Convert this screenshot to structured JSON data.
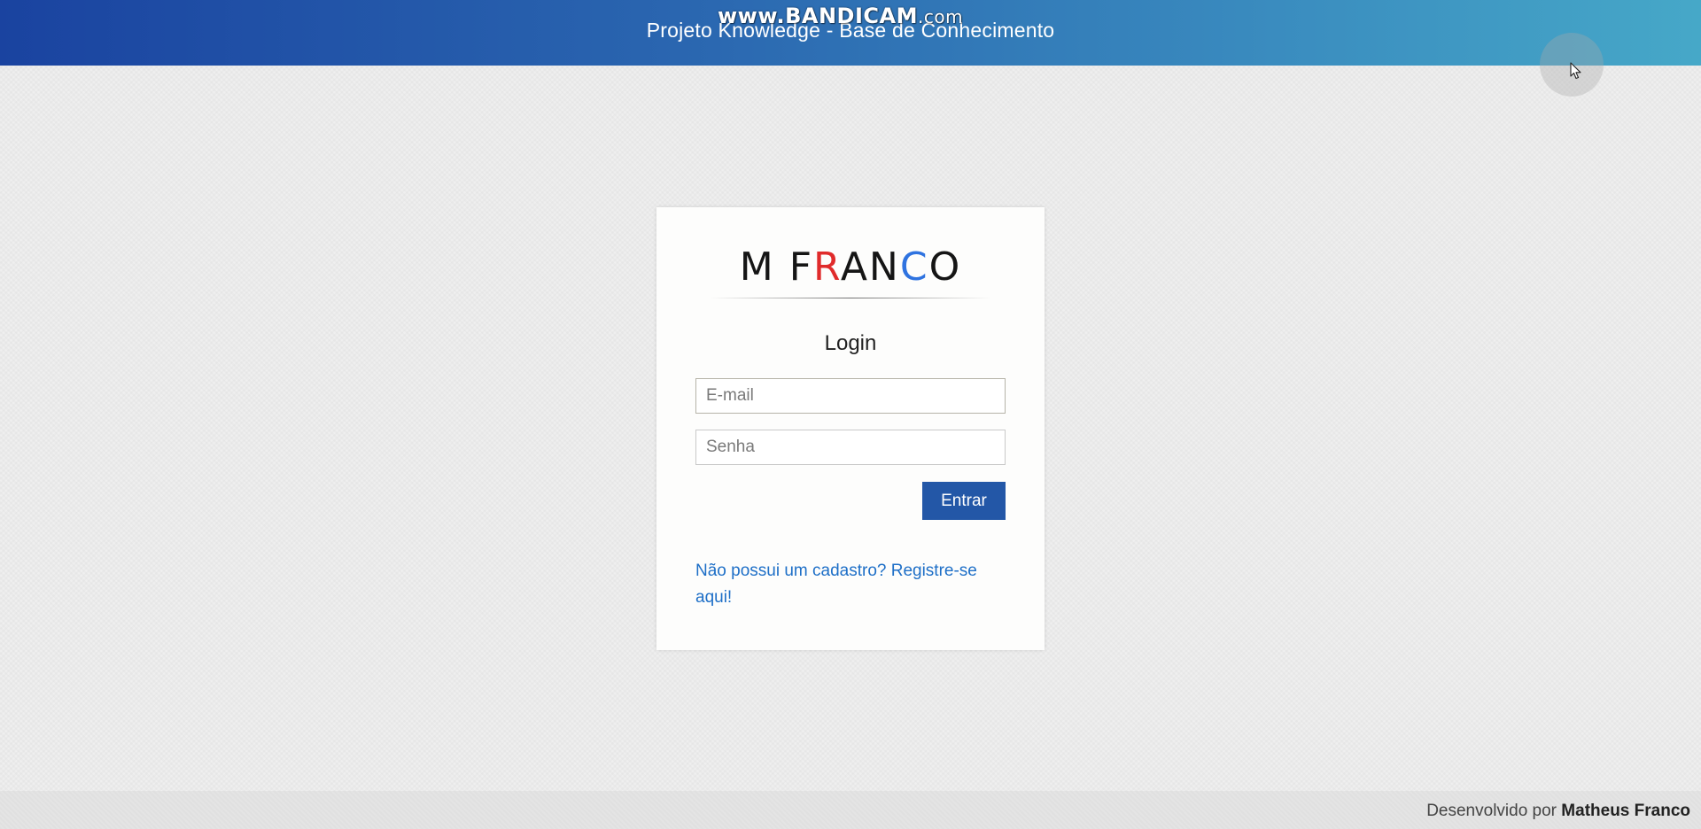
{
  "header": {
    "title": "Projeto Knowledge - Base de Conhecimento",
    "watermark_main": "www.BANDICAM",
    "watermark_suffix": ".com"
  },
  "logo": {
    "parts": [
      "M F",
      "R",
      "AN",
      "C",
      "O"
    ],
    "colors": {
      "default": "#151515",
      "red": "#e02b2b",
      "blue": "#2f73e0"
    }
  },
  "login": {
    "title": "Login",
    "email_placeholder": "E-mail",
    "email_value": "",
    "password_placeholder": "Senha",
    "password_value": "",
    "submit_label": "Entrar",
    "register_link": "Não possui um cadastro? Registre-se aqui!"
  },
  "footer": {
    "prefix": "Desenvolvido por",
    "author": "Matheus Franco"
  },
  "icons": {
    "cursor": "mouse-pointer-icon"
  },
  "colors": {
    "header_gradient_start": "#1a43a0",
    "header_gradient_end": "#46a8c8",
    "primary_button": "#2357a7",
    "link": "#1e6fc7",
    "background": "#efefef"
  }
}
